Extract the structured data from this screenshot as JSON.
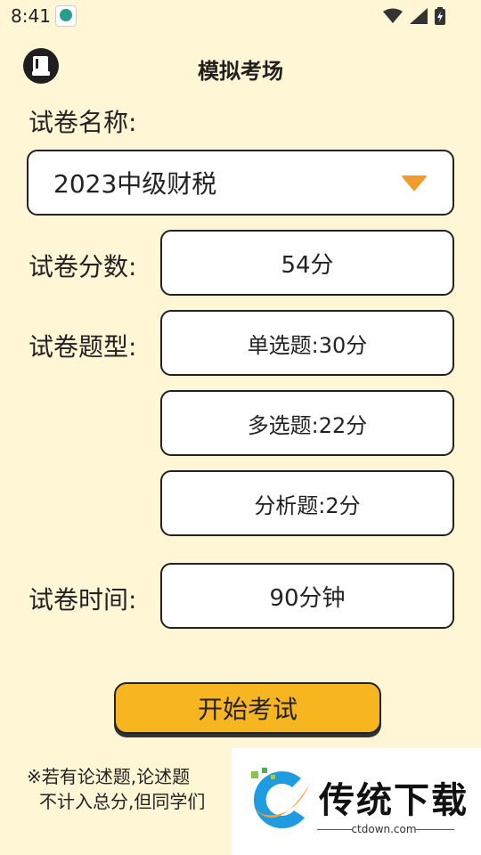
{
  "status": {
    "time": "8:41"
  },
  "header": {
    "title": "模拟考场"
  },
  "form": {
    "paper_name_label": "试卷名称:",
    "paper_name_value": "2023中级财税",
    "score_label": "试卷分数:",
    "score_value": "54分",
    "types_label": "试卷题型:",
    "types": [
      "单选题:30分",
      "多选题:22分",
      "分析题:2分"
    ],
    "time_label": "试卷时间:",
    "time_value": "90分钟"
  },
  "actions": {
    "start_label": "开始考试"
  },
  "note": {
    "line1": "※若有论述题,论述题",
    "line2": "不计入总分,但同学们"
  },
  "watermark": {
    "brand": "传统下载",
    "url": "ctdown.com"
  },
  "colors": {
    "background": "#FFF6D6",
    "accent": "#F7B51F",
    "arrow": "#F39C2D"
  }
}
